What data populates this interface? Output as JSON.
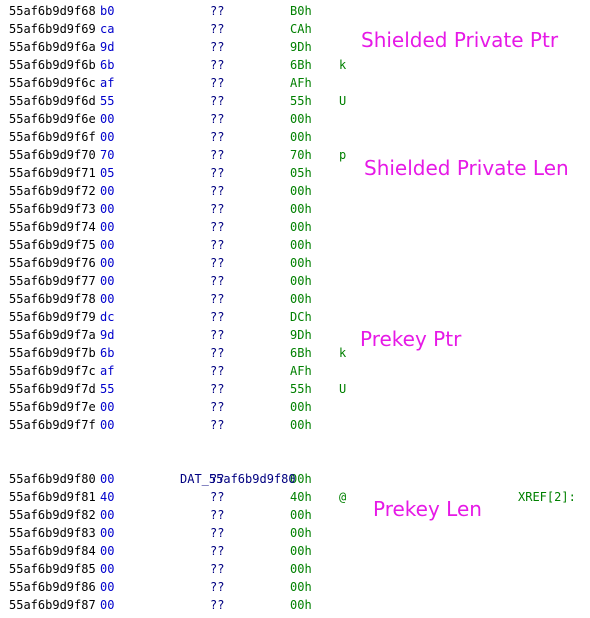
{
  "listing": {
    "rows_a": [
      {
        "addr": "55af6b9d9f68",
        "byte": "b0",
        "q": "??",
        "hex": "B0h",
        "chr": ""
      },
      {
        "addr": "55af6b9d9f69",
        "byte": "ca",
        "q": "??",
        "hex": "CAh",
        "chr": ""
      },
      {
        "addr": "55af6b9d9f6a",
        "byte": "9d",
        "q": "??",
        "hex": "9Dh",
        "chr": ""
      },
      {
        "addr": "55af6b9d9f6b",
        "byte": "6b",
        "q": "??",
        "hex": "6Bh",
        "chr": "k"
      },
      {
        "addr": "55af6b9d9f6c",
        "byte": "af",
        "q": "??",
        "hex": "AFh",
        "chr": ""
      },
      {
        "addr": "55af6b9d9f6d",
        "byte": "55",
        "q": "??",
        "hex": "55h",
        "chr": "U"
      },
      {
        "addr": "55af6b9d9f6e",
        "byte": "00",
        "q": "??",
        "hex": "00h",
        "chr": ""
      },
      {
        "addr": "55af6b9d9f6f",
        "byte": "00",
        "q": "??",
        "hex": "00h",
        "chr": ""
      },
      {
        "addr": "55af6b9d9f70",
        "byte": "70",
        "q": "??",
        "hex": "70h",
        "chr": "p"
      },
      {
        "addr": "55af6b9d9f71",
        "byte": "05",
        "q": "??",
        "hex": "05h",
        "chr": ""
      },
      {
        "addr": "55af6b9d9f72",
        "byte": "00",
        "q": "??",
        "hex": "00h",
        "chr": ""
      },
      {
        "addr": "55af6b9d9f73",
        "byte": "00",
        "q": "??",
        "hex": "00h",
        "chr": ""
      },
      {
        "addr": "55af6b9d9f74",
        "byte": "00",
        "q": "??",
        "hex": "00h",
        "chr": ""
      },
      {
        "addr": "55af6b9d9f75",
        "byte": "00",
        "q": "??",
        "hex": "00h",
        "chr": ""
      },
      {
        "addr": "55af6b9d9f76",
        "byte": "00",
        "q": "??",
        "hex": "00h",
        "chr": ""
      },
      {
        "addr": "55af6b9d9f77",
        "byte": "00",
        "q": "??",
        "hex": "00h",
        "chr": ""
      },
      {
        "addr": "55af6b9d9f78",
        "byte": "00",
        "q": "??",
        "hex": "00h",
        "chr": ""
      },
      {
        "addr": "55af6b9d9f79",
        "byte": "dc",
        "q": "??",
        "hex": "DCh",
        "chr": ""
      },
      {
        "addr": "55af6b9d9f7a",
        "byte": "9d",
        "q": "??",
        "hex": "9Dh",
        "chr": ""
      },
      {
        "addr": "55af6b9d9f7b",
        "byte": "6b",
        "q": "??",
        "hex": "6Bh",
        "chr": "k"
      },
      {
        "addr": "55af6b9d9f7c",
        "byte": "af",
        "q": "??",
        "hex": "AFh",
        "chr": ""
      },
      {
        "addr": "55af6b9d9f7d",
        "byte": "55",
        "q": "??",
        "hex": "55h",
        "chr": "U"
      },
      {
        "addr": "55af6b9d9f7e",
        "byte": "00",
        "q": "??",
        "hex": "00h",
        "chr": ""
      },
      {
        "addr": "55af6b9d9f7f",
        "byte": "00",
        "q": "??",
        "hex": "00h",
        "chr": ""
      }
    ],
    "label": {
      "name": "DAT_55af6b9d9f80",
      "xref": "XREF[2]:"
    },
    "rows_b": [
      {
        "addr": "55af6b9d9f80",
        "byte": "00",
        "q": "??",
        "hex": "00h",
        "chr": ""
      },
      {
        "addr": "55af6b9d9f81",
        "byte": "40",
        "q": "??",
        "hex": "40h",
        "chr": "@"
      },
      {
        "addr": "55af6b9d9f82",
        "byte": "00",
        "q": "??",
        "hex": "00h",
        "chr": ""
      },
      {
        "addr": "55af6b9d9f83",
        "byte": "00",
        "q": "??",
        "hex": "00h",
        "chr": ""
      },
      {
        "addr": "55af6b9d9f84",
        "byte": "00",
        "q": "??",
        "hex": "00h",
        "chr": ""
      },
      {
        "addr": "55af6b9d9f85",
        "byte": "00",
        "q": "??",
        "hex": "00h",
        "chr": ""
      },
      {
        "addr": "55af6b9d9f86",
        "byte": "00",
        "q": "??",
        "hex": "00h",
        "chr": ""
      },
      {
        "addr": "55af6b9d9f87",
        "byte": "00",
        "q": "??",
        "hex": "00h",
        "chr": ""
      }
    ]
  },
  "annotations": {
    "shielded_private_ptr": "Shielded Private Ptr",
    "shielded_private_len": "Shielded Private Len",
    "prekey_ptr": "Prekey Ptr",
    "prekey_len": "Prekey Len"
  },
  "colors": {
    "address": "#000000",
    "byte": "#0000cc",
    "undefined": "#000080",
    "hex_value": "#008000",
    "label": "#000080",
    "annotation": "#e619e6"
  }
}
